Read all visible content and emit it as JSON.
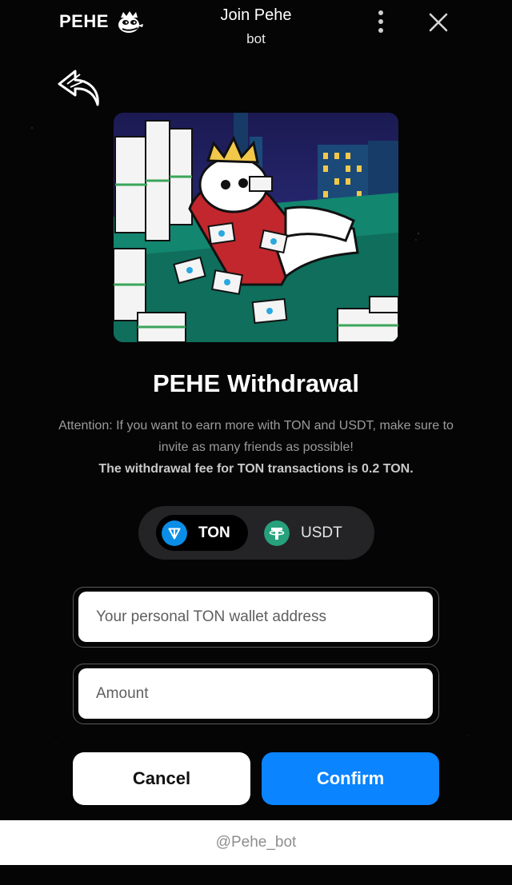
{
  "topbar": {
    "brand": "PEHE",
    "title": "Join Pehe",
    "subtitle": "bot"
  },
  "headline": "PEHE Withdrawal",
  "info": {
    "attention": "Attention: If you want to earn more with TON and USDT, make sure to invite as many friends as possible!",
    "fee": "The withdrawal fee for TON transactions is 0.2 TON."
  },
  "currency": {
    "options": [
      {
        "label": "TON",
        "selected": true,
        "color": "#0088cc"
      },
      {
        "label": "USDT",
        "selected": false,
        "color": "#26a17b"
      }
    ]
  },
  "form": {
    "wallet_placeholder": "Your personal TON wallet address",
    "amount_placeholder": "Amount"
  },
  "buttons": {
    "cancel": "Cancel",
    "confirm": "Confirm"
  },
  "footer": "@Pehe_bot",
  "colors": {
    "background": "#050506",
    "accent": "#0a84ff"
  }
}
